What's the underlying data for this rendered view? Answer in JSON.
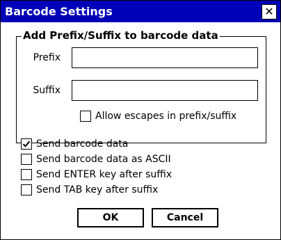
{
  "window": {
    "title": "Barcode Settings",
    "close_icon": "close-icon"
  },
  "group": {
    "title": "Add Prefix/Suffix to barcode data",
    "prefix_label": "Prefix",
    "prefix_value": "",
    "suffix_label": "Suffix",
    "suffix_value": "",
    "allow_escapes_label": "Allow escapes in prefix/suffix",
    "allow_escapes_checked": false
  },
  "options": [
    {
      "label": "Send barcode data",
      "checked": true
    },
    {
      "label": "Send barcode data as ASCII",
      "checked": false
    },
    {
      "label": "Send ENTER key after suffix",
      "checked": false
    },
    {
      "label": "Send TAB key after suffix",
      "checked": false
    }
  ],
  "buttons": {
    "ok_label": "OK",
    "cancel_label": "Cancel"
  },
  "colors": {
    "titlebar": "#0000b8"
  }
}
